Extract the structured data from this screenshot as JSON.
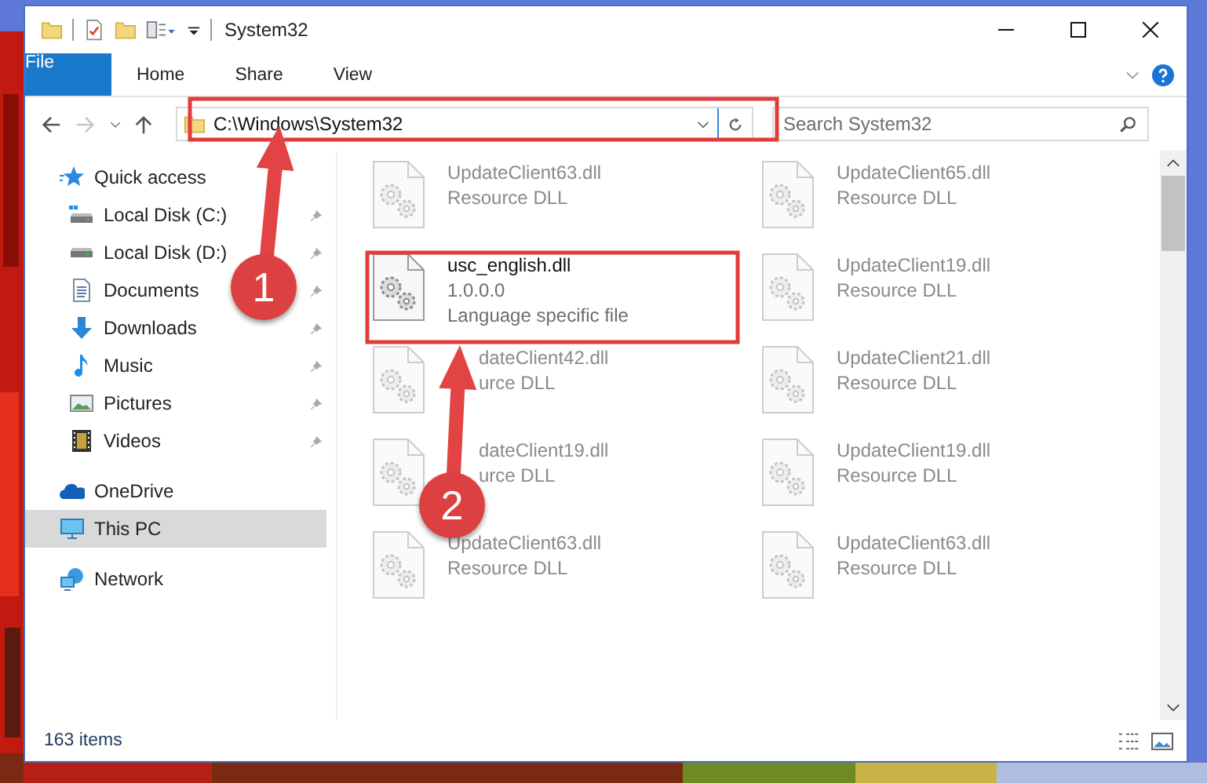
{
  "window": {
    "title": "System32"
  },
  "ribbon_tabs": [
    {
      "label": "File",
      "kind": "file",
      "selected": false
    },
    {
      "label": "Home",
      "kind": "tab",
      "selected": false
    },
    {
      "label": "Share",
      "kind": "tab",
      "selected": false
    },
    {
      "label": "View",
      "kind": "tab",
      "selected": false
    }
  ],
  "address_bar": {
    "path": "C:\\Windows\\System32"
  },
  "search": {
    "placeholder": "Search System32"
  },
  "nav_pane": [
    {
      "label": "Quick access",
      "kind": "star",
      "selected": false,
      "children": [
        {
          "label": "Local Disk (C:)",
          "kind": "system-drive",
          "pinned": true,
          "selected": false
        },
        {
          "label": "Local Disk (D:)",
          "kind": "drive",
          "pinned": true,
          "selected": false
        },
        {
          "label": "Documents",
          "kind": "documents",
          "pinned": true,
          "selected": false
        },
        {
          "label": "Downloads",
          "kind": "downloads",
          "pinned": true,
          "selected": false
        },
        {
          "label": "Music",
          "kind": "music",
          "pinned": true,
          "selected": false
        },
        {
          "label": "Pictures",
          "kind": "pictures",
          "pinned": true,
          "selected": false
        },
        {
          "label": "Videos",
          "kind": "videos",
          "pinned": true,
          "selected": false
        }
      ]
    },
    {
      "label": "OneDrive",
      "kind": "cloud",
      "selected": false
    },
    {
      "label": "This PC",
      "kind": "pc",
      "selected": true
    },
    {
      "label": "Network",
      "kind": "network",
      "selected": false
    }
  ],
  "files": [
    {
      "name": "UpdateClient63.dll",
      "details": [
        "Resource DLL"
      ],
      "blurred": true
    },
    {
      "name": "UpdateClient65.dll",
      "details": [
        "Resource DLL"
      ],
      "blurred": true
    },
    {
      "name": "usc_english.dll",
      "details": [
        "1.0.0.0",
        "Language specific file"
      ],
      "blurred": false
    },
    {
      "name": "UpdateClient19.dll",
      "details": [
        "Resource DLL"
      ],
      "blurred": true
    },
    {
      "name": "dateClient42.dll",
      "details": [
        "urce DLL"
      ],
      "blurred": true
    },
    {
      "name": "UpdateClient21.dll",
      "details": [
        "Resource DLL"
      ],
      "blurred": true
    },
    {
      "name": "dateClient19.dll",
      "details": [
        "urce DLL"
      ],
      "blurred": true
    },
    {
      "name": "UpdateClient19.dll",
      "details": [
        "Resource DLL"
      ],
      "blurred": true
    },
    {
      "name": "UpdateClient63.dll",
      "details": [
        "Resource DLL"
      ],
      "blurred": true
    },
    {
      "name": "UpdateClient63.dll",
      "details": [
        "Resource DLL"
      ],
      "blurred": true
    }
  ],
  "status_bar": {
    "item_count": "163 items"
  },
  "annotations": [
    {
      "number": "1"
    },
    {
      "number": "2"
    }
  ]
}
